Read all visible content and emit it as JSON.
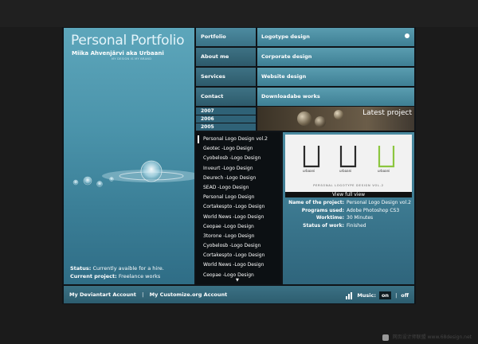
{
  "brand": {
    "title": "Personal Portfolio",
    "subtitle": "Miika Ahvenjärvi aka Urbaani",
    "tagline": "MY DESIGN IS MY BRAND"
  },
  "nav": {
    "items": [
      "Portfolio",
      "About me",
      "Services",
      "Contact"
    ],
    "active": "Portfolio"
  },
  "submenu": {
    "items": [
      "Logotype design",
      "Corporate design",
      "Website design",
      "Downloadabe works"
    ]
  },
  "years": [
    "2007",
    "2006",
    "2005"
  ],
  "banner": {
    "label": "Latest project"
  },
  "projects": [
    "Personal Logo Design vol.2",
    "Geotec -Logo Design",
    "Cyobelosb -Logo Design",
    "Inveurt -Logo Design",
    "Deurech -Logo Design",
    "SEAD -Logo Design",
    "Personal Logo Design",
    "Cortakespto -Logo Design",
    "World News -Logo Design",
    "Ceopae -Logo Design",
    "3torone -Logo Design",
    "Cyobelosb -Logo Design",
    "Cortakespto -Logo Design",
    "World News -Logo Design",
    "Ceopae -Logo Design"
  ],
  "preview": {
    "thumb_caption": "PERSONAL LOGOTYPE DESIGN VOL.2",
    "logo_word": "urbaani",
    "view_full": "View full view",
    "details": [
      {
        "key": "Name of the project:",
        "value": "Personal Logo Design vol.2"
      },
      {
        "key": "Programs used:",
        "value": "Adobe Photoshop CS3"
      },
      {
        "key": "Worktime:",
        "value": "30 Minutes"
      },
      {
        "key": "Status of work:",
        "value": "Finished"
      }
    ]
  },
  "status": {
    "status_label": "Status:",
    "status_value": "Currently avaible for a hire.",
    "project_label": "Current project:",
    "project_value": "Freelance works"
  },
  "footer": {
    "link1": "My Deviantart Account",
    "separator": "|",
    "link2": "My Customize.org Account",
    "music_label": "Music:",
    "on": "on",
    "off": "off"
  },
  "watermark": "网页设计师联盟  www.68design.net",
  "colors": {
    "teal": "#4a93aa",
    "dark": "#101418",
    "accent": "#8cc63f"
  }
}
